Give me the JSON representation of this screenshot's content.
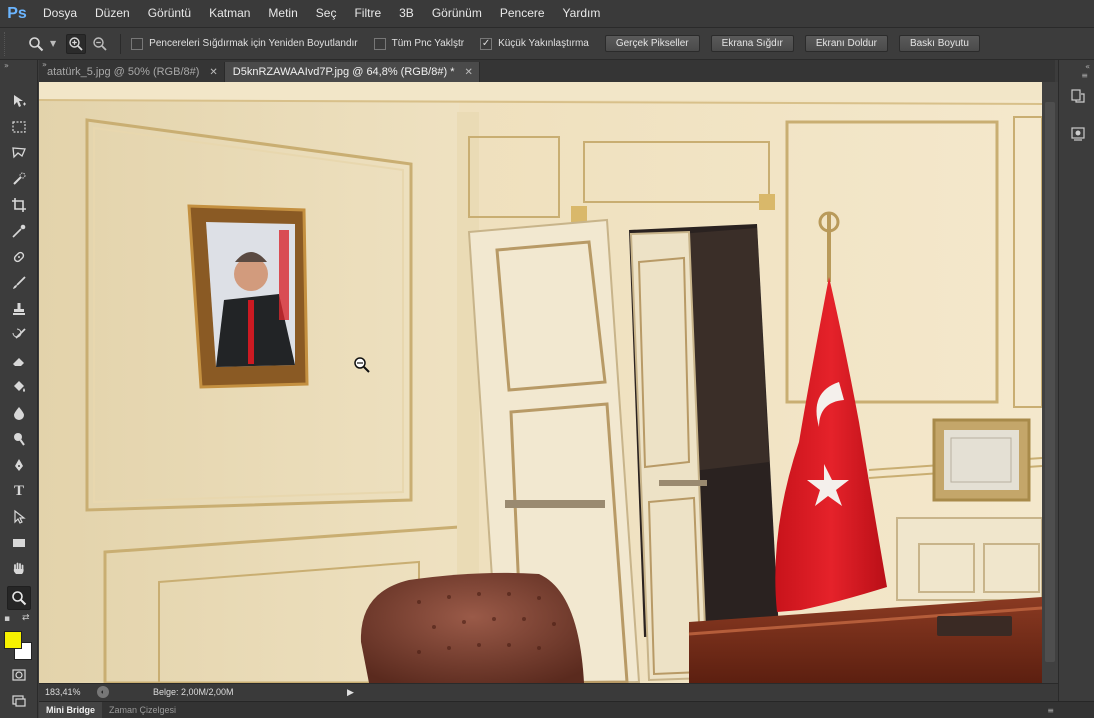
{
  "app": {
    "logo": "Ps"
  },
  "menu": [
    "Dosya",
    "Düzen",
    "Görüntü",
    "Katman",
    "Metin",
    "Seç",
    "Filtre",
    "3B",
    "Görünüm",
    "Pencere",
    "Yardım"
  ],
  "options_bar": {
    "tool_icon": "zoom-icon",
    "zoom_in_icon": "zoom-in-icon",
    "zoom_out_icon": "zoom-out-icon",
    "checkboxes": [
      {
        "label": "Pencereleri Sığdırmak için Yeniden Boyutlandır",
        "checked": false
      },
      {
        "label": "Tüm Pnc Yaklştr",
        "checked": false
      },
      {
        "label": "Küçük Yakınlaştırma",
        "checked": true
      }
    ],
    "buttons": [
      "Gerçek Pikseller",
      "Ekrana Sığdır",
      "Ekranı Doldur",
      "Baskı Boyutu"
    ]
  },
  "tabs": [
    {
      "label": "atatürk_5.jpg @ 50% (RGB/8#)",
      "active": false
    },
    {
      "label": "D5knRZAWAAIvd7P.jpg @ 64,8% (RGB/8#) *",
      "active": true
    }
  ],
  "toolbar": {
    "tools": [
      "move-tool",
      "marquee-tool",
      "lasso-tool",
      "quick-selection-tool",
      "crop-tool",
      "eyedropper-tool",
      "healing-brush-tool",
      "brush-tool",
      "clone-stamp-tool",
      "history-brush-tool",
      "eraser-tool",
      "paint-bucket-tool",
      "blur-tool",
      "dodge-tool",
      "pen-tool",
      "type-tool",
      "path-selection-tool",
      "rectangle-tool",
      "hand-tool",
      "zoom-tool"
    ],
    "active_tool": "zoom-tool",
    "foreground_color": "#f7f100",
    "background_color": "#ffffff"
  },
  "status": {
    "zoom": "183,41%",
    "doc_info": "Belge: 2,00M/2,00M"
  },
  "bottom_panels": [
    {
      "label": "Mini Bridge",
      "active": true
    },
    {
      "label": "Zaman Çizelgesi",
      "active": false
    }
  ],
  "right_dock": [
    "history-icon",
    "properties-icon"
  ]
}
